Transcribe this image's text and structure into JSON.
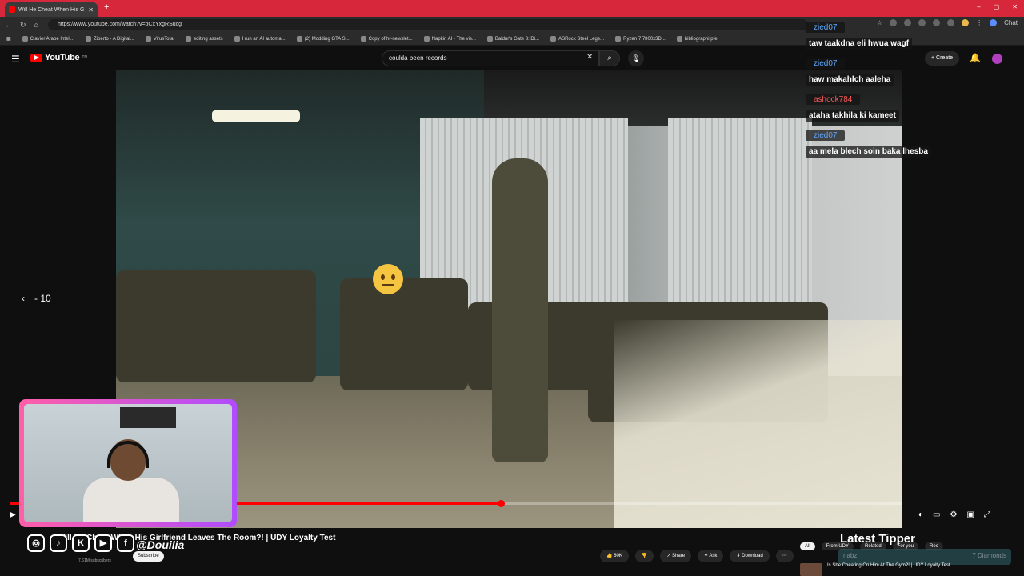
{
  "browser": {
    "tab_title": "Will He Cheat When His Girlfriend",
    "url": "https://www.youtube.com/watch?v=bCxYxgRSucg",
    "new_tab_glyph": "+",
    "bookmarks": [
      "Clavier Arabe Intell...",
      "Ziperto - A Digital...",
      "VirusTotal",
      "editing assets",
      "I run an AI automa...",
      "(2) Modding GTA S...",
      "Copy of hr-newslet...",
      "Napkin AI - The vis...",
      "Baldur's Gate 3: Di...",
      "ASRock Steel Lege...",
      "Ryzen 7 7800x3D...",
      "bibliographi pfe"
    ],
    "chat_button": "Chat"
  },
  "youtube": {
    "logo_text": "YouTube",
    "logo_tm": "TN",
    "search_value": "coulda been records",
    "create_label": "Create",
    "accent_color": "#ff0000"
  },
  "player": {
    "rewind_label": "- 10",
    "progress_fraction": 0.55
  },
  "video_info": {
    "title": "Will He Cheat When His Girlfriend Leaves The Room?! | UDY Loyalty Test",
    "subscribers": "7.61M subscribers",
    "subscribe_label": "Subscribe",
    "like_count": "60K",
    "share_label": "Share",
    "ask_label": "Ask",
    "download_label": "Download"
  },
  "overlay": {
    "handle": "@Douilia",
    "latest_tipper_title": "Latest Tipper",
    "tipper_name": "nabz",
    "tipper_amount": "7 Diamonds"
  },
  "chips": [
    "All",
    "From UDY",
    "Related",
    "For you",
    "Rec"
  ],
  "related_video": {
    "title": "Is She Cheating On Him At The Gym?! | UDY Loyalty Test"
  },
  "chat": [
    {
      "user": "zied07",
      "user_color": "#5ea7ff",
      "text": "taw taakdna eli hwua wagf"
    },
    {
      "user": "zied07",
      "user_color": "#5ea7ff",
      "text": "haw makahlch aaleha"
    },
    {
      "user": "ashock784",
      "user_color": "#ff5a5a",
      "text": "ataha takhila ki kameet"
    },
    {
      "user": "zied07",
      "user_color": "#5ea7ff",
      "text": "aa mela blech soin baka lhesba"
    }
  ]
}
